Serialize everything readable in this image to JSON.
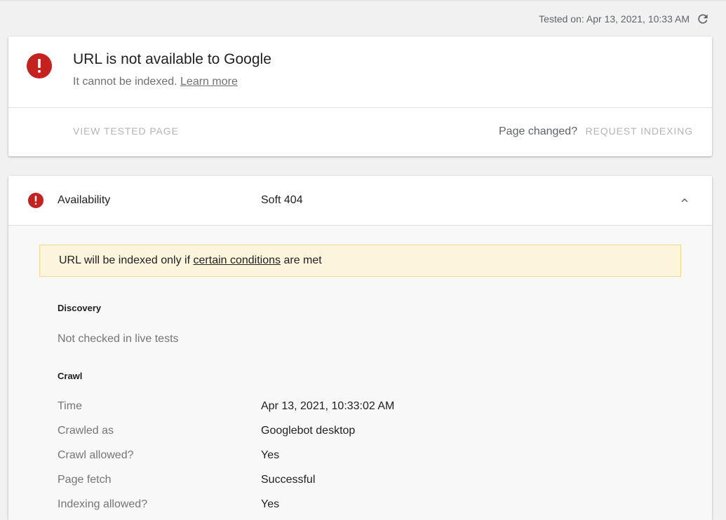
{
  "header": {
    "tested_on": "Tested on: Apr 13, 2021, 10:33 AM",
    "refresh_icon": "refresh-icon"
  },
  "status_card": {
    "icon": "error-icon",
    "title": "URL is not available to Google",
    "subtitle": "It cannot be indexed.",
    "learn_more": "Learn more",
    "view_tested_page": "VIEW TESTED PAGE",
    "page_changed": "Page changed?",
    "request_indexing": "REQUEST INDEXING"
  },
  "availability": {
    "icon": "error-icon",
    "label": "Availability",
    "value": "Soft 404",
    "toggle_icon": "chevron-up-icon",
    "notice": {
      "prefix": "URL will be indexed only if",
      "link": "certain conditions",
      "suffix": "are met"
    },
    "discovery": {
      "heading": "Discovery",
      "text": "Not checked in live tests"
    },
    "crawl": {
      "heading": "Crawl",
      "rows": [
        {
          "label": "Time",
          "value": "Apr 13, 2021, 10:33:02 AM"
        },
        {
          "label": "Crawled as",
          "value": "Googlebot desktop"
        },
        {
          "label": "Crawl allowed?",
          "value": "Yes"
        },
        {
          "label": "Page fetch",
          "value": "Successful"
        },
        {
          "label": "Indexing allowed?",
          "value": "Yes"
        }
      ]
    }
  },
  "colors": {
    "error_red": "#c5221f",
    "notice_bg": "#fdf4dc",
    "notice_border": "#f3d98e"
  }
}
